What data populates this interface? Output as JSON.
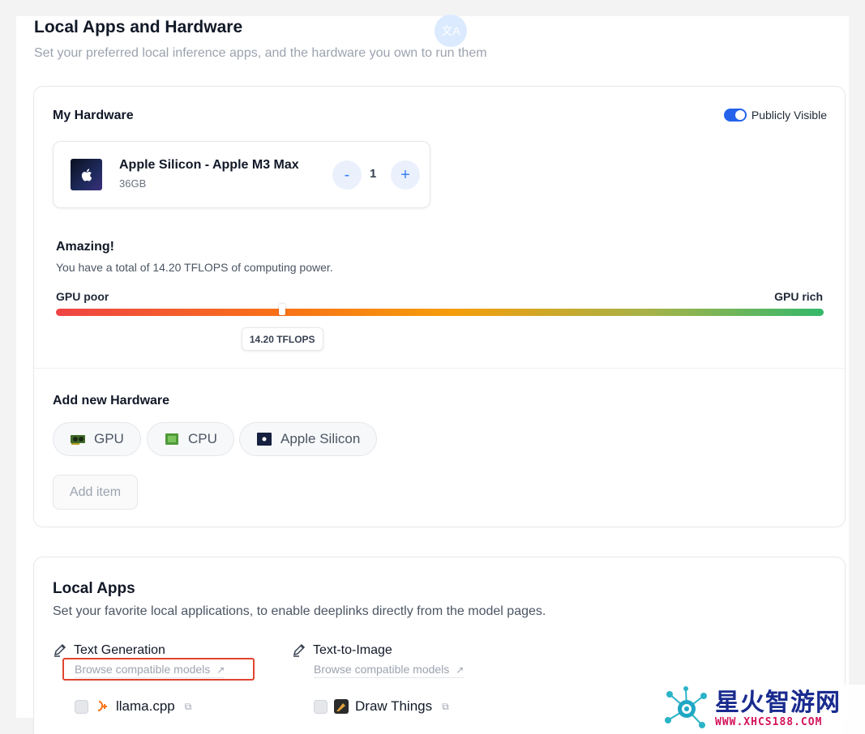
{
  "header": {
    "badge": "文A",
    "title": "Local Apps and Hardware",
    "subtitle": "Set your preferred local inference apps, and the hardware you own to run them"
  },
  "hardware": {
    "title": "My Hardware",
    "visibility": {
      "label": "Publicly Visible",
      "enabled": true
    },
    "device": {
      "name": "Apple Silicon - Apple M3 Max",
      "memory": "36GB",
      "minus": "-",
      "quantity": "1",
      "plus": "+"
    },
    "power": {
      "headline": "Amazing!",
      "summary": "You have a total of 14.20 TFLOPS of computing power.",
      "min_label": "GPU poor",
      "max_label": "GPU rich",
      "value_label": "14.20 TFLOPS",
      "level_fraction": 0.295
    },
    "add": {
      "title": "Add new Hardware",
      "options": [
        {
          "label": "GPU",
          "icon": "gpu-icon"
        },
        {
          "label": "CPU",
          "icon": "cpu-icon"
        },
        {
          "label": "Apple Silicon",
          "icon": "apple-silicon-icon"
        }
      ],
      "add_item_label": "Add item"
    }
  },
  "local_apps": {
    "title": "Local Apps",
    "description": "Set your favorite local applications, to enable deeplinks directly from the model pages.",
    "categories": [
      {
        "name": "Text Generation",
        "browse_label": "Browse compatible models",
        "apps": [
          {
            "name": "llama.cpp",
            "checked": false,
            "icon": "llama-cpp-icon"
          }
        ]
      },
      {
        "name": "Text-to-Image",
        "browse_label": "Browse compatible models",
        "apps": [
          {
            "name": "Draw Things",
            "checked": false,
            "icon": "draw-things-icon"
          }
        ]
      }
    ]
  },
  "watermark": {
    "name": "星火智游网",
    "url": "WWW.XHCS188.COM"
  },
  "colors": {
    "accent": "#2563eb",
    "highlight_box": "#e0452e",
    "watermark_text": "#1a2b8f",
    "watermark_url": "#d4145a"
  }
}
